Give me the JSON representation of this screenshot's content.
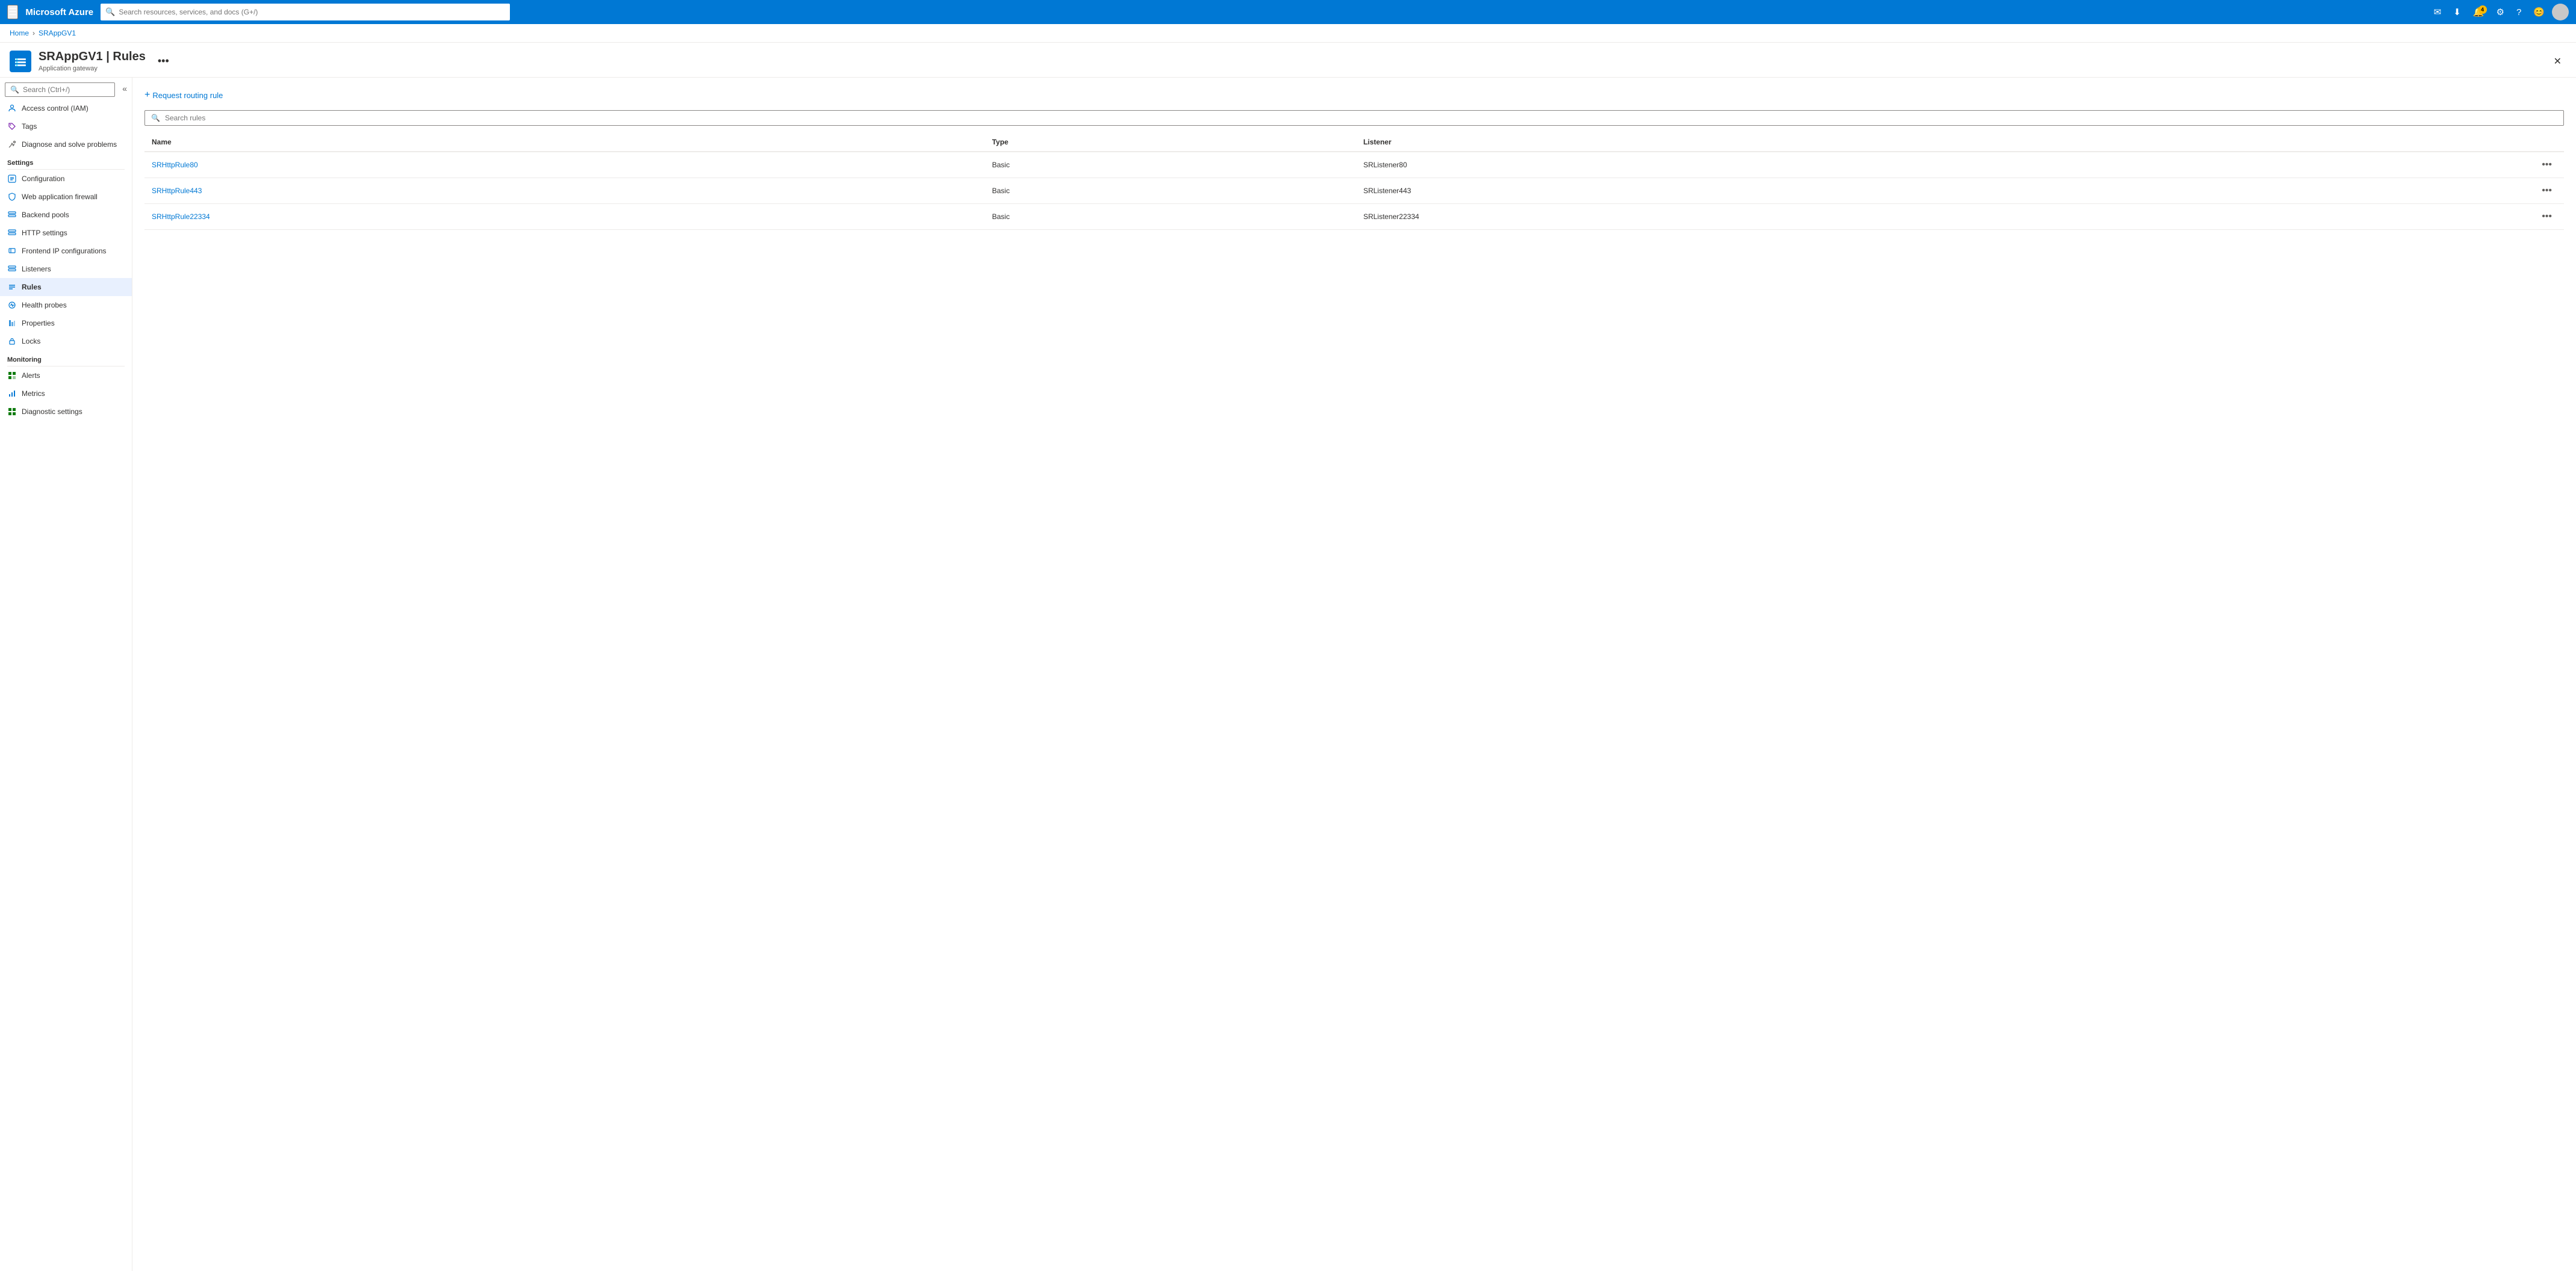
{
  "topnav": {
    "hamburger": "☰",
    "logo": "Microsoft Azure",
    "search_placeholder": "Search resources, services, and docs (G+/)",
    "notification_count": "4",
    "icons": [
      "✉",
      "↓",
      "🔔",
      "⚙",
      "?",
      "😊"
    ]
  },
  "breadcrumb": {
    "home": "Home",
    "current": "SRAppGV1"
  },
  "page_header": {
    "title": "SRAppGV1 | Rules",
    "subtitle": "Application gateway",
    "more_label": "•••",
    "close_label": "✕"
  },
  "sidebar": {
    "search_placeholder": "Search (Ctrl+/)",
    "items": [
      {
        "id": "access-control",
        "label": "Access control (IAM)",
        "icon": "👤",
        "active": false
      },
      {
        "id": "tags",
        "label": "Tags",
        "icon": "🏷",
        "active": false
      },
      {
        "id": "diagnose",
        "label": "Diagnose and solve problems",
        "icon": "🔧",
        "active": false
      }
    ],
    "settings_section": "Settings",
    "settings_items": [
      {
        "id": "configuration",
        "label": "Configuration",
        "icon": "⚙",
        "active": false
      },
      {
        "id": "waf",
        "label": "Web application firewall",
        "icon": "🛡",
        "active": false
      },
      {
        "id": "backend-pools",
        "label": "Backend pools",
        "icon": "≡",
        "active": false
      },
      {
        "id": "http-settings",
        "label": "HTTP settings",
        "icon": "≡",
        "active": false
      },
      {
        "id": "frontend-ip",
        "label": "Frontend IP configurations",
        "icon": "🖥",
        "active": false
      },
      {
        "id": "listeners",
        "label": "Listeners",
        "icon": "≡",
        "active": false
      },
      {
        "id": "rules",
        "label": "Rules",
        "icon": "≡",
        "active": true
      },
      {
        "id": "health-probes",
        "label": "Health probes",
        "icon": "📍",
        "active": false
      },
      {
        "id": "properties",
        "label": "Properties",
        "icon": "📊",
        "active": false
      },
      {
        "id": "locks",
        "label": "Locks",
        "icon": "🔒",
        "active": false
      }
    ],
    "monitoring_section": "Monitoring",
    "monitoring_items": [
      {
        "id": "alerts",
        "label": "Alerts",
        "icon": "🟩",
        "active": false
      },
      {
        "id": "metrics",
        "label": "Metrics",
        "icon": "📈",
        "active": false
      },
      {
        "id": "diagnostic-settings",
        "label": "Diagnostic settings",
        "icon": "🟩",
        "active": false
      }
    ]
  },
  "content": {
    "add_rule_label": "Request routing rule",
    "search_placeholder": "Search rules",
    "table": {
      "columns": [
        "Name",
        "Type",
        "Listener"
      ],
      "rows": [
        {
          "name": "SRHttpRule80",
          "type": "Basic",
          "listener": "SRListener80"
        },
        {
          "name": "SRHttpRule443",
          "type": "Basic",
          "listener": "SRListener443"
        },
        {
          "name": "SRHttpRule22334",
          "type": "Basic",
          "listener": "SRListener22334"
        }
      ]
    }
  }
}
